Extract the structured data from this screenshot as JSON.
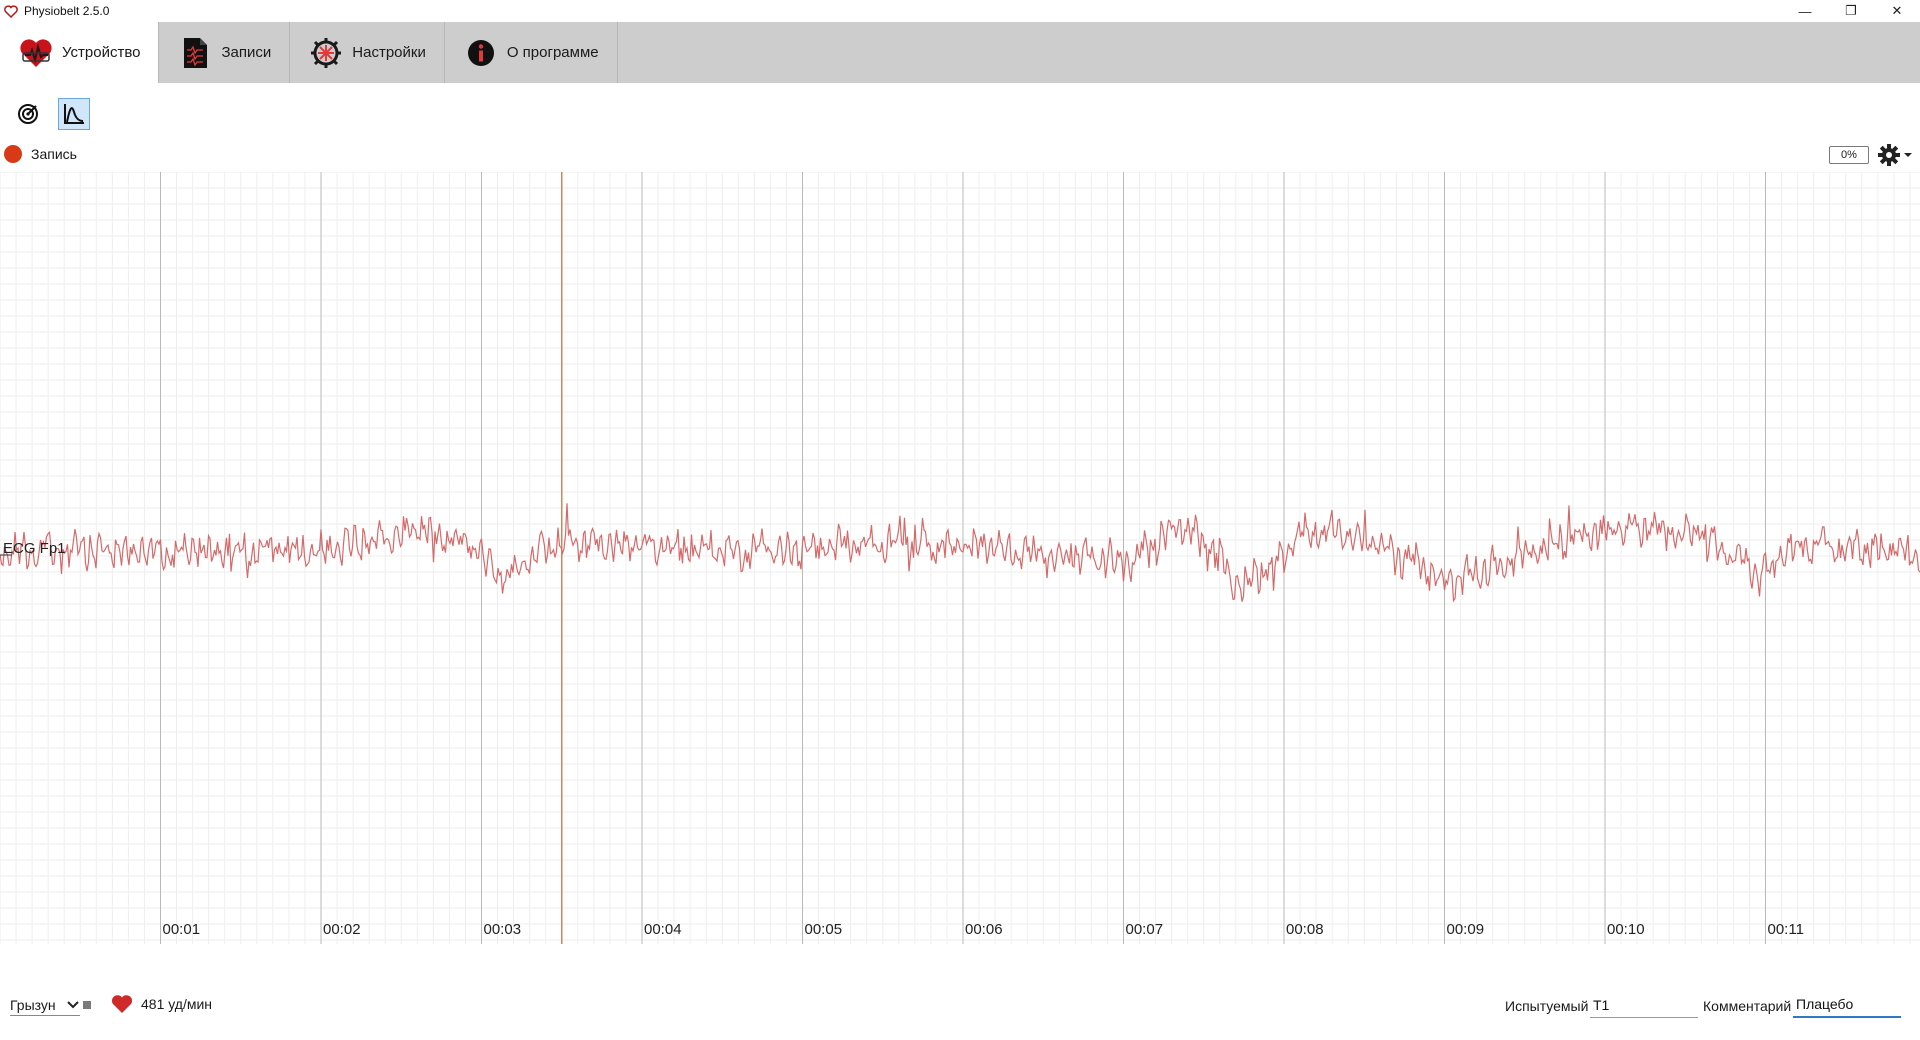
{
  "window": {
    "title": "Physiobelt 2.5.0",
    "minimize": "—",
    "restore": "❐",
    "close": "✕"
  },
  "tabs": [
    {
      "label": "Устройство",
      "icon": "heart-device-icon",
      "active": true
    },
    {
      "label": "Записи",
      "icon": "document-icon",
      "active": false
    },
    {
      "label": "Настройки",
      "icon": "gear-icon",
      "active": false
    },
    {
      "label": "О программе",
      "icon": "info-icon",
      "active": false
    }
  ],
  "toolbar": {
    "buttons": [
      {
        "icon": "radar-icon",
        "active": false
      },
      {
        "icon": "waveform-icon",
        "active": true
      }
    ]
  },
  "recording": {
    "label": "Запись",
    "progress_text": "0%",
    "status_color": "#d93a16"
  },
  "plot": {
    "channel_label": "ECG Fp1",
    "trace_color": "#d46a6a",
    "marker_color": "#c8885a",
    "marker_time_s": 3.5,
    "x_ticks": [
      "00:01",
      "00:02",
      "00:03",
      "00:04",
      "00:05",
      "00:06",
      "00:07",
      "00:08",
      "00:09",
      "00:10",
      "00:11"
    ]
  },
  "bottom": {
    "species_value": "Грызун",
    "heart_rate_text": "481 уд/мин",
    "subject_label": "Испытуемый",
    "subject_value": "T1",
    "comment_label": "Комментарий",
    "comment_value": "Плацебо"
  }
}
